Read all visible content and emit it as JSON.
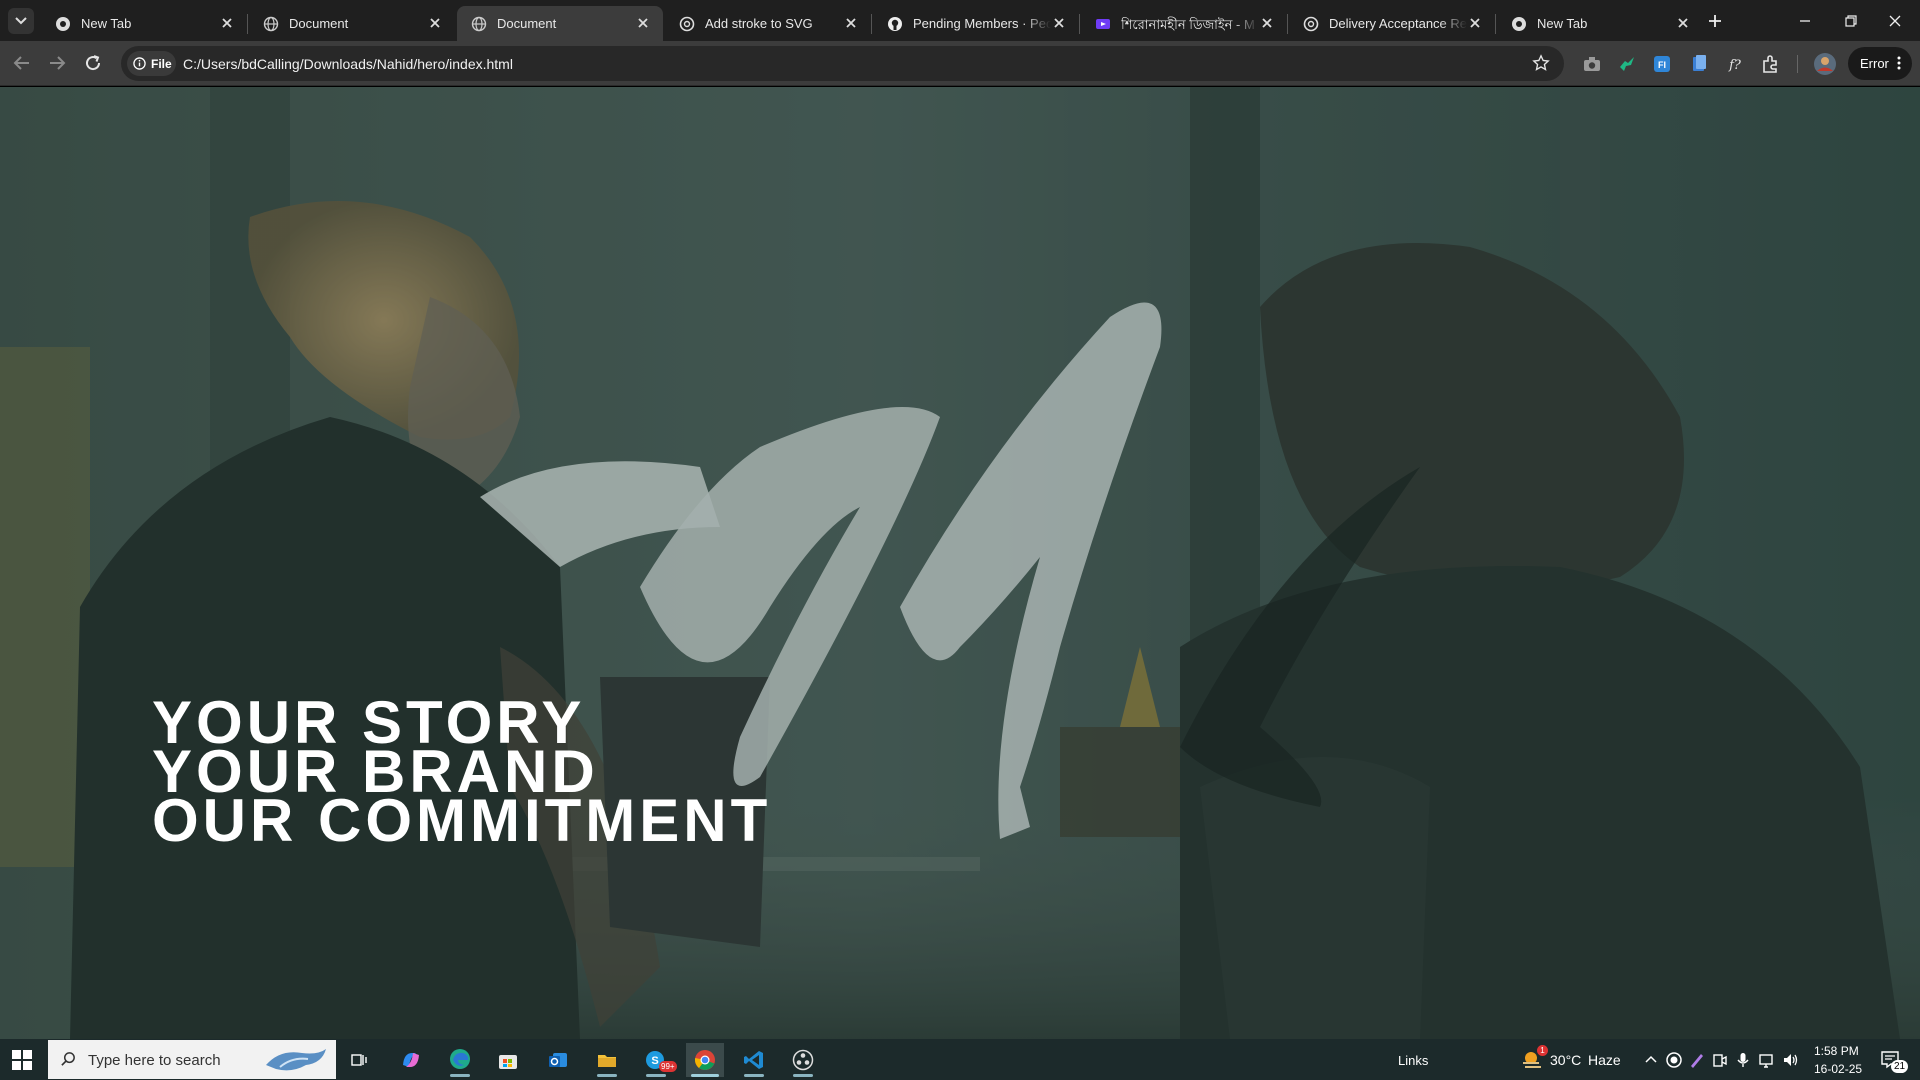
{
  "browser": {
    "tabs": [
      {
        "title": "New Tab",
        "icon": "chrome-icon",
        "active": false
      },
      {
        "title": "Document",
        "icon": "globe-icon",
        "active": false
      },
      {
        "title": "Document",
        "icon": "globe-icon",
        "active": true
      },
      {
        "title": "Add stroke to SVG",
        "icon": "openai-icon",
        "active": false
      },
      {
        "title": "Pending Members · People",
        "icon": "github-icon",
        "active": false
      },
      {
        "title": "শিরোনামহীন ডিজাইন - M",
        "icon": "canva-icon",
        "active": false
      },
      {
        "title": "Delivery Acceptance Requ",
        "icon": "openai-icon",
        "active": false
      },
      {
        "title": "New Tab",
        "icon": "chrome-icon",
        "active": false
      }
    ],
    "omnibox": {
      "scheme_label": "File",
      "url": "C:/Users/bdCalling/Downloads/Nahid/hero/index.html"
    },
    "profile_status": "Error"
  },
  "page": {
    "hero": {
      "lines": [
        "YOUR STORY",
        "YOUR BRAND",
        "OUR COMMITMENT"
      ]
    }
  },
  "taskbar": {
    "search_placeholder": "Type here to search",
    "links_label": "Links",
    "weather": {
      "temp": "30°C",
      "condition": "Haze",
      "alert_count": "1"
    },
    "clock": {
      "time": "1:58 PM",
      "date": "16-02-25"
    },
    "notification_count": "21",
    "skype_badge": "99+"
  },
  "colors": {
    "tab_strip": "#1f1f1f",
    "toolbar": "#3c3c3c",
    "omnibox": "#282828",
    "hero_text": "#ffffff",
    "overlay_tint": "#2f4540",
    "taskbar": "#1c2a2b"
  }
}
